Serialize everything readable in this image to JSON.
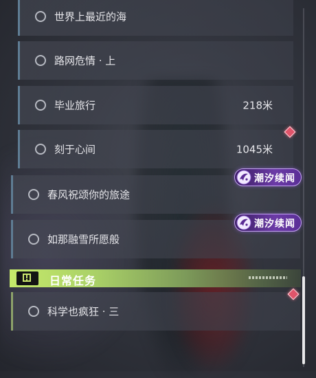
{
  "tracked_quests": [
    {
      "name": "世界上最近的海",
      "distance": ""
    },
    {
      "name": "路网危情 · 上",
      "distance": ""
    },
    {
      "name": "毕业旅行",
      "distance": "218米"
    },
    {
      "name": "刻于心间",
      "distance": "1045米"
    },
    {
      "name": "春风祝颂你的旅途",
      "distance": ""
    },
    {
      "name": "如那融雪所愿般",
      "distance": ""
    }
  ],
  "event_badge": {
    "label": "潮汐续闻",
    "icon": "event-emblem-icon"
  },
  "daily_section": {
    "title": "日常任务",
    "icon": "alert-icon"
  },
  "daily_quests": [
    {
      "name": "科学也疯狂 · 三",
      "distance": ""
    }
  ],
  "colors": {
    "main_quest_accent": "#5f7d94",
    "daily_accent": "#c6ea6a",
    "event_badge": "#6b3aa6",
    "marker": "#e0546a"
  }
}
